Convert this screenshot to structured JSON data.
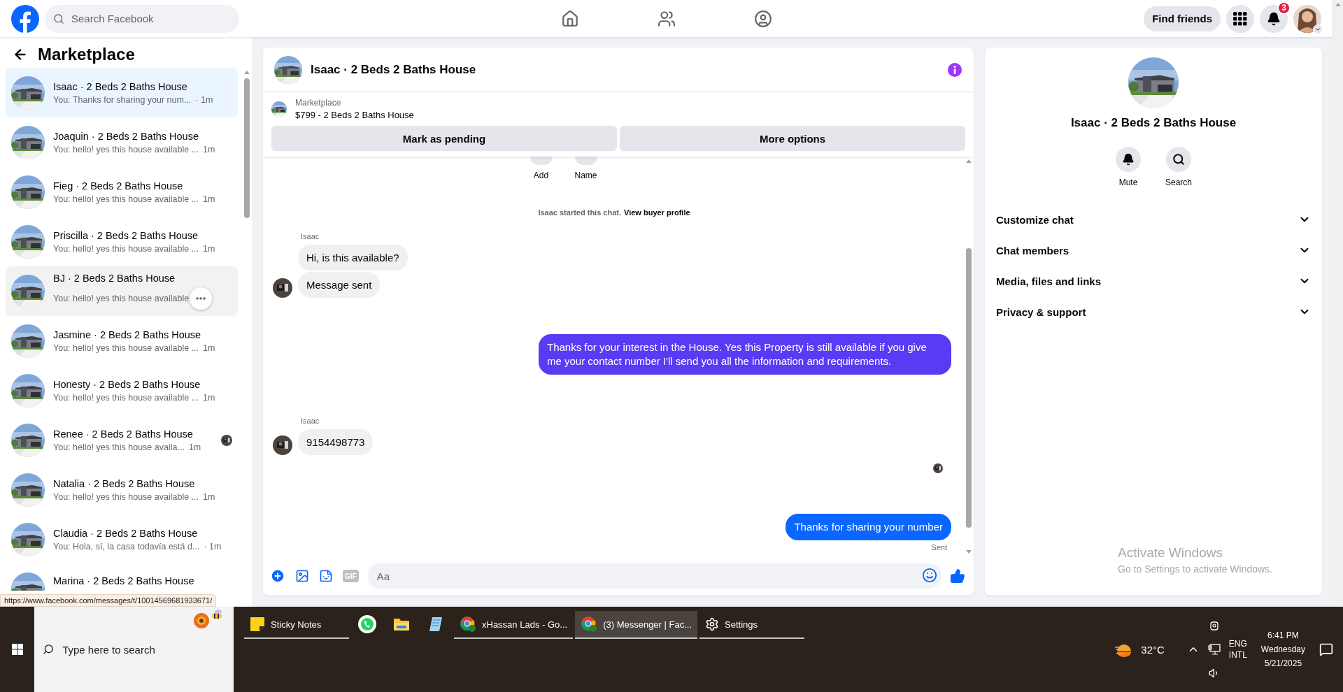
{
  "top_bar": {
    "search": {
      "placeholder": "Search Facebook"
    },
    "find_friends": "Find friends",
    "notification_count": "3"
  },
  "sidebar": {
    "title": "Marketplace",
    "conversations": [
      {
        "title": "Isaac · 2 Beds 2 Baths House",
        "preview": "You: Thanks for sharing your num...",
        "time": "· 1m",
        "selected": true,
        "hovered": false,
        "seen": false
      },
      {
        "title": "Joaquin · 2 Beds 2 Baths House",
        "preview": "You: hello! yes this house available ...",
        "time": "1m",
        "selected": false,
        "hovered": false,
        "seen": false
      },
      {
        "title": "Fieg · 2 Beds 2 Baths House",
        "preview": "You: hello! yes this house available ...",
        "time": "1m",
        "selected": false,
        "hovered": false,
        "seen": false
      },
      {
        "title": "Priscilla · 2 Beds 2 Baths House",
        "preview": "You: hello! yes this house available ...",
        "time": "1m",
        "selected": false,
        "hovered": false,
        "seen": false
      },
      {
        "title": "BJ · 2 Beds 2 Baths House",
        "preview": "You: hello! yes this house available",
        "selected": false,
        "hovered": true,
        "seen": false
      },
      {
        "title": "Jasmine · 2 Beds 2 Baths House",
        "preview": "You: hello! yes this house available ...",
        "time": "1m",
        "selected": false,
        "hovered": false,
        "seen": false
      },
      {
        "title": "Honesty · 2 Beds 2 Baths House",
        "preview": "You: hello! yes this house available ...",
        "time": "1m",
        "selected": false,
        "hovered": false,
        "seen": false
      },
      {
        "title": "Renee · 2 Beds 2 Baths House",
        "preview": "You: hello! yes this house availa...",
        "time": "1m",
        "selected": false,
        "hovered": false,
        "seen": true
      },
      {
        "title": "Natalia · 2 Beds 2 Baths House",
        "preview": "You: hello! yes this house available ...",
        "time": "1m",
        "selected": false,
        "hovered": false,
        "seen": false
      },
      {
        "title": "Claudia · 2 Beds 2 Baths House",
        "preview": "You: Hola, sí, la casa todavía está d...",
        "time": "· 1m",
        "selected": false,
        "hovered": false,
        "seen": false
      },
      {
        "title": "Marina · 2 Beds 2 Baths House",
        "selected": false,
        "hovered": false,
        "seen": false
      }
    ]
  },
  "status_url": "https://www.facebook.com/messages/t/10014569681933671/",
  "chat": {
    "title": "Isaac · 2 Beds 2 Baths House",
    "listing": {
      "source": "Marketplace",
      "summary": "$799 - 2 Beds 2 Baths House"
    },
    "actions": [
      "Mark as pending",
      "More options"
    ],
    "quick_actions": [
      "Add",
      "Name"
    ],
    "notice": "Isaac started this chat.",
    "notice_link": "View buyer profile",
    "messages": [
      {
        "kind": "incoming",
        "sender": "Isaac",
        "bubbles": [
          "Hi, is this available?",
          "Message sent"
        ]
      },
      {
        "kind": "outgoing",
        "text": "Thanks for your interest in the House. Yes this Property is still available if you give me your contact number I'll send you all the information and requirements.",
        "color": "#5a3bf4"
      },
      {
        "kind": "incoming",
        "sender": "Isaac",
        "bubbles": [
          "9154498773"
        ]
      },
      {
        "kind": "read_receipt"
      },
      {
        "kind": "outgoing",
        "text": "Thanks for sharing your number",
        "color": "#0a66ff",
        "status": "Sent"
      }
    ],
    "composer": {
      "placeholder": "Aa",
      "gif_label": "GIF"
    }
  },
  "details": {
    "name": "Isaac · 2 Beds 2 Baths House",
    "actions": [
      "Mute",
      "Search"
    ],
    "sections": [
      {
        "label": "Customize chat",
        "expanded": false
      },
      {
        "label": "Chat members",
        "expanded": false
      },
      {
        "label": "Media, files and links",
        "expanded": false
      },
      {
        "label": "Privacy & support",
        "expanded": false
      }
    ]
  },
  "os_notice": {
    "title": "Activate Windows",
    "body": "Go to Settings to activate Windows."
  },
  "taskbar": {
    "search_placeholder": "Type here to search",
    "apps": [
      {
        "kind": "notes",
        "label": "Sticky Notes",
        "running": true,
        "selected": false
      },
      {
        "kind": "chat",
        "running": false,
        "selected": false
      },
      {
        "kind": "folder",
        "running": false,
        "selected": false
      },
      {
        "kind": "notepad",
        "running": false,
        "selected": false
      },
      {
        "kind": "browser",
        "label": "xHassan Lads - Go...",
        "running": true,
        "selected": false
      },
      {
        "kind": "browser",
        "label": "(3) Messenger | Fac...",
        "running": true,
        "selected": true
      },
      {
        "kind": "settings",
        "label": "Settings",
        "running": true,
        "selected": false
      }
    ],
    "weather": "32°C",
    "language": [
      "ENG",
      "INTL"
    ],
    "time": "6:41 PM",
    "day": "Wednesday",
    "date": "5/21/2025"
  }
}
